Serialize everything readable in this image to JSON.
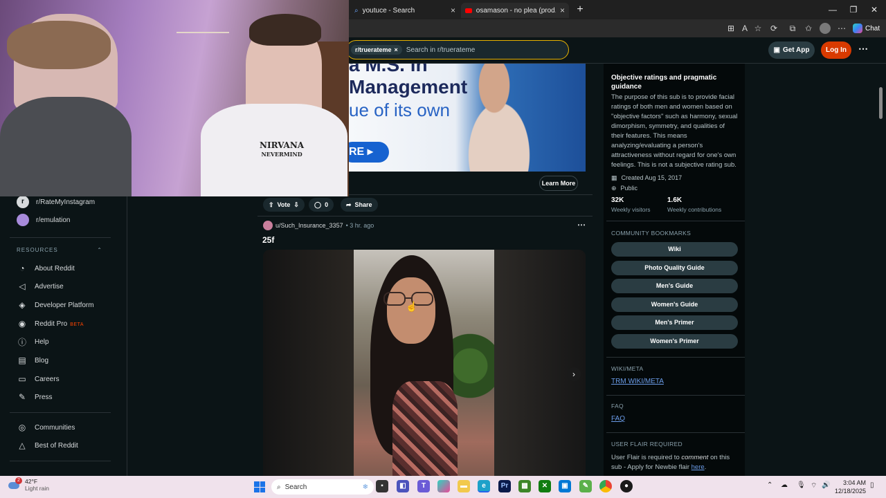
{
  "browser": {
    "tabs": [
      {
        "label": "youtuce - Search",
        "icon": "search-icon"
      },
      {
        "label": "osamason - no plea (prod. boolymon)",
        "icon": "youtube-icon"
      }
    ]
  },
  "header": {
    "search_chip": "r/truerateme",
    "search_placeholder": "Search in r/truerateme",
    "get_app": "Get App",
    "login": "Log In"
  },
  "webcam": {
    "shirt_text_1": "NIRVANA",
    "shirt_text_2": "NEVERMIND"
  },
  "left_sidebar": {
    "communities": [
      "r/RateMyInstagram",
      "r/emulation"
    ],
    "resources_header": "RESOURCES",
    "resources": [
      {
        "label": "About Reddit",
        "icon": "reddit-alien-icon"
      },
      {
        "label": "Advertise",
        "icon": "megaphone-icon"
      },
      {
        "label": "Developer Platform",
        "icon": "developer-icon"
      },
      {
        "label": "Reddit Pro",
        "icon": "reddit-pro-icon",
        "badge": "BETA"
      },
      {
        "label": "Help",
        "icon": "help-icon"
      },
      {
        "label": "Blog",
        "icon": "blog-icon"
      },
      {
        "label": "Careers",
        "icon": "careers-icon"
      },
      {
        "label": "Press",
        "icon": "press-icon"
      }
    ],
    "more": [
      {
        "label": "Communities",
        "icon": "communities-icon"
      },
      {
        "label": "Best of Reddit",
        "icon": "best-of-icon"
      }
    ]
  },
  "ad": {
    "line1": "a M.S. in",
    "line2": "Management",
    "line3": "ue of its own",
    "cta": "RE",
    "learn_more": "Learn More"
  },
  "feed": {
    "actions": {
      "vote": "Vote",
      "comments": "0",
      "share": "Share"
    },
    "post": {
      "author": "u/Such_Insurance_3357",
      "time": "• 3 hr. ago",
      "title": "25f"
    }
  },
  "right_sidebar": {
    "title": "Objective ratings and pragmatic guidance",
    "description": "The purpose of this sub is to provide facial ratings of both men and women based on \"objective factors\" such as harmony, sexual dimorphism, symmetry, and qualities of their features. This means analyzing/evaluating a person's attractiveness without regard for one's own feelings. This is not a subjective rating sub.",
    "created": "Created Aug 15, 2017",
    "visibility": "Public",
    "stats": [
      {
        "value": "32K",
        "label": "Weekly visitors"
      },
      {
        "value": "1.6K",
        "label": "Weekly contributions"
      }
    ],
    "bookmarks_header": "COMMUNITY BOOKMARKS",
    "bookmarks": [
      "Wiki",
      "Photo Quality Guide",
      "Men's Guide",
      "Women's Guide",
      "Men's Primer",
      "Women's Primer"
    ],
    "wiki_header": "WIKI/META",
    "wiki_link": "TRM WIKI/META",
    "faq_header": "FAQ",
    "faq_link": "FAQ",
    "flair_header": "USER FLAIR REQUIRED",
    "flair_text_1": "User Flair is required to ",
    "flair_em": "comment",
    "flair_text_2": " on this sub - Apply for Newbie flair ",
    "flair_link": "here",
    "flair_end": "."
  },
  "taskbar": {
    "weather_badge": "2",
    "temperature": "42°F",
    "condition": "Light rain",
    "search": "Search",
    "time": "3:04 AM",
    "date": "12/18/2025",
    "chat": "Chat"
  },
  "colors": {
    "accent": "#d93a00",
    "link": "#6b9ce8",
    "search_border": "#e8b200"
  }
}
